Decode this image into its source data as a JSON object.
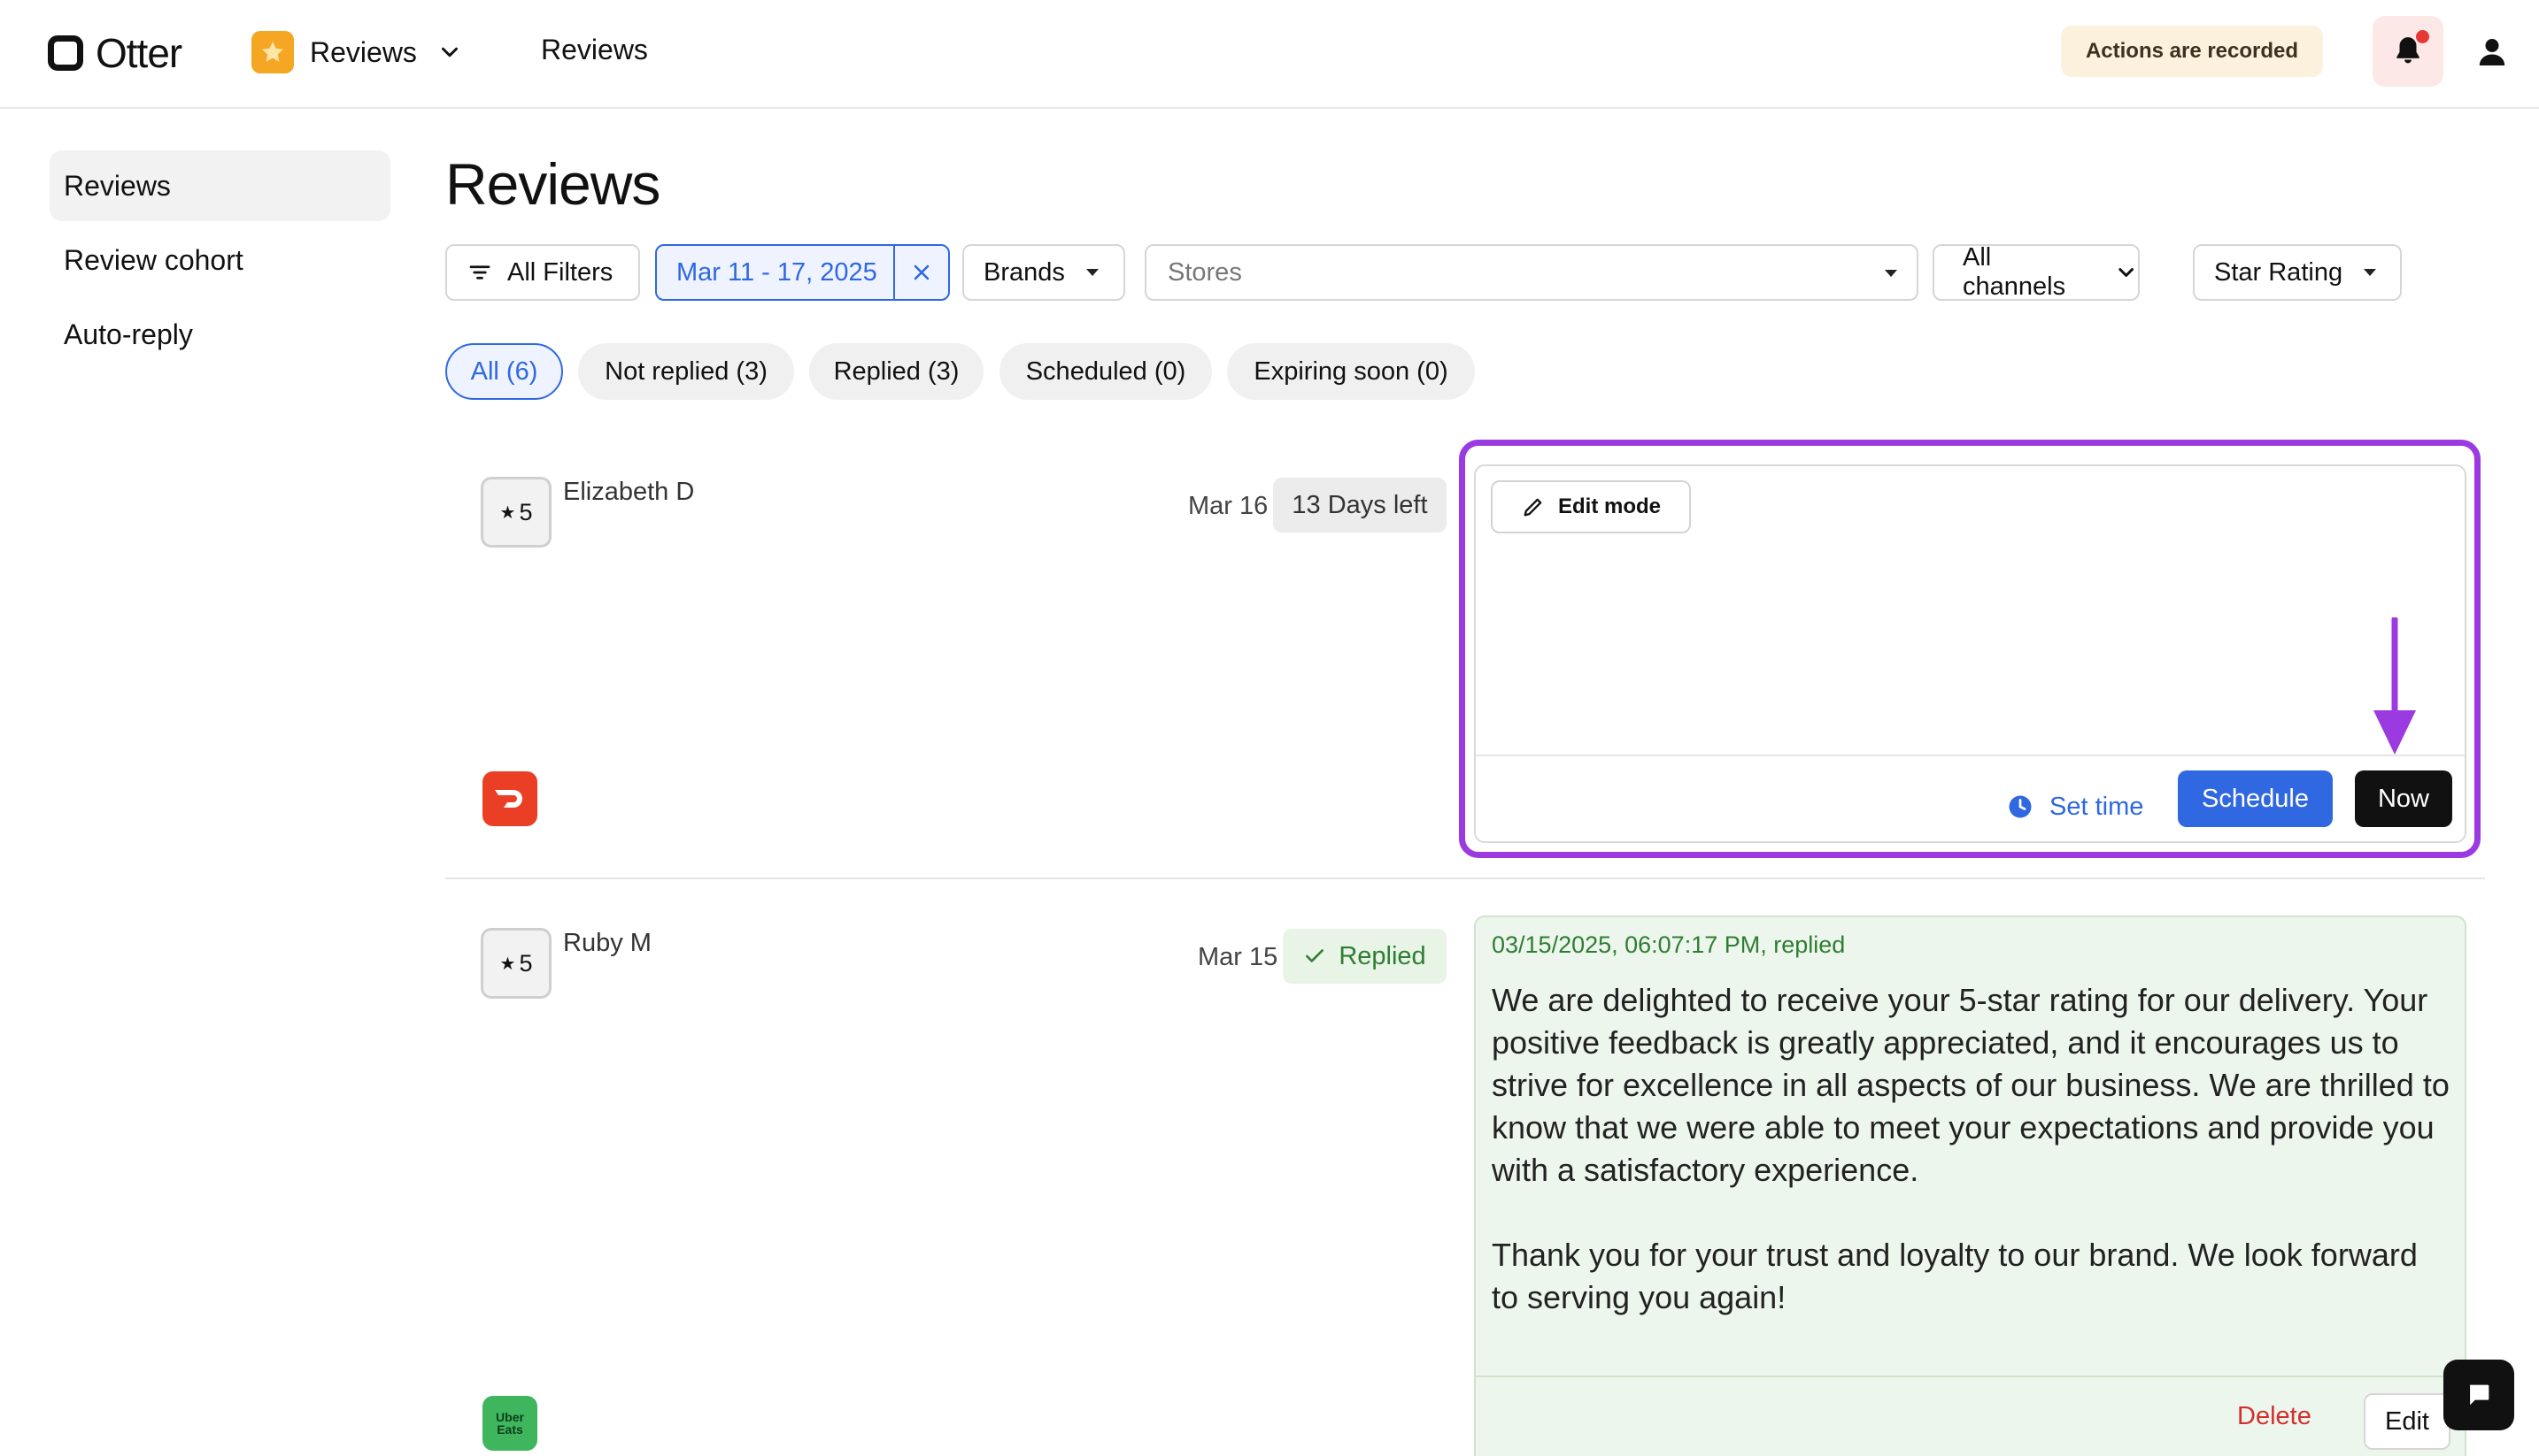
{
  "topbar": {
    "logo_text": "Otter",
    "app_switcher_label": "Reviews",
    "breadcrumb": "Reviews",
    "recorded_badge": "Actions are recorded"
  },
  "sidebar": {
    "items": [
      {
        "label": "Reviews",
        "active": true
      },
      {
        "label": "Review cohort",
        "active": false
      },
      {
        "label": "Auto-reply",
        "active": false
      }
    ]
  },
  "main": {
    "title": "Reviews",
    "filters": {
      "all_filters": "All Filters",
      "date_range": "Mar 11 - 17, 2025",
      "brands": "Brands",
      "stores_placeholder": "Stores",
      "channels": "All channels",
      "star_rating": "Star Rating"
    },
    "tabs": [
      {
        "label": "All (6)",
        "active": true
      },
      {
        "label": "Not replied (3)",
        "active": false
      },
      {
        "label": "Replied (3)",
        "active": false
      },
      {
        "label": "Scheduled (0)",
        "active": false
      },
      {
        "label": "Expiring soon (0)",
        "active": false
      }
    ],
    "reviews": [
      {
        "rating": "5",
        "reviewer": "Elizabeth D",
        "date": "Mar 16",
        "status": "13 Days left",
        "channel": "doordash-icon",
        "editor": {
          "edit_mode_label": "Edit mode",
          "set_time_label": "Set time",
          "schedule_label": "Schedule",
          "now_label": "Now"
        }
      },
      {
        "rating": "5",
        "reviewer": "Ruby M",
        "date": "Mar 15",
        "status": "Replied",
        "channel": "ubereats-icon",
        "channel_text": "Uber Eats",
        "reply": {
          "meta": "03/15/2025, 06:07:17 PM, replied",
          "text": "We are delighted to receive your 5-star rating for our delivery. Your positive feedback is greatly appreciated, and it encourages us to strive for excellence in all aspects of our business. We are thrilled to know that we were able to meet your expectations and provide you with a satisfactory experience.\n\nThank you for your trust and loyalty to our brand. We look forward to serving you again!",
          "delete_label": "Delete",
          "edit_label": "Edit"
        }
      }
    ]
  },
  "colors": {
    "accent": "#2f68e0",
    "highlight": "#9b3ae0",
    "replied_green": "#2f7d32",
    "doordash_red": "#eb3f25",
    "ubereats_green": "#3fb55d"
  }
}
